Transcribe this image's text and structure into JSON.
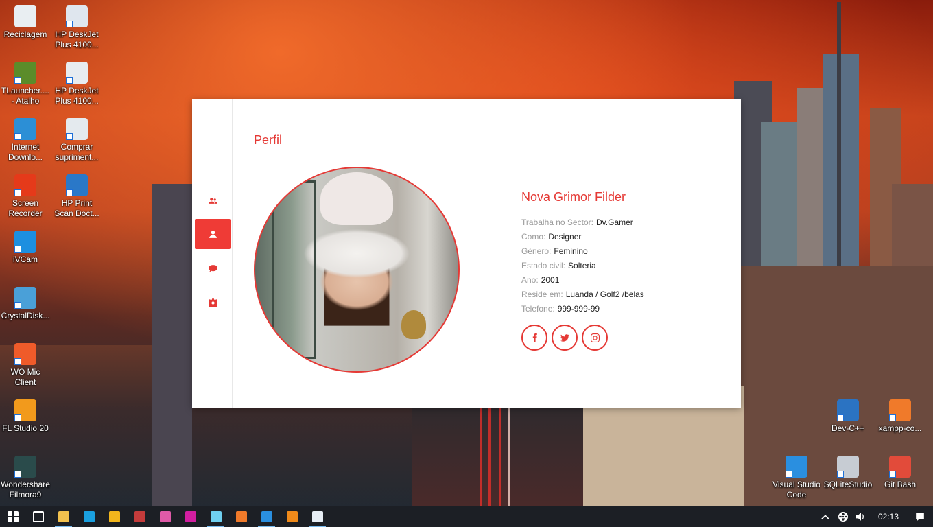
{
  "desktop": {
    "left_icons": [
      {
        "label": "Reciclagem",
        "icon": "recycle-bin-icon",
        "color": "#e9eef2"
      },
      {
        "label": "TLauncher....\n- Atalho",
        "icon": "minecraft-grass-icon",
        "color": "#5b8c2a"
      },
      {
        "label": "Internet\nDownlo...",
        "icon": "internet-download-manager-icon",
        "color": "#2c8fd6"
      },
      {
        "label": "Screen\nRecorder",
        "icon": "screen-recorder-icon",
        "color": "#e53a1a"
      },
      {
        "label": "iVCam",
        "icon": "ivcam-icon",
        "color": "#1d8fe0"
      },
      {
        "label": "CrystalDisk...",
        "icon": "crystaldisk-icon",
        "color": "#4aa0d8"
      },
      {
        "label": "WO Mic\nClient",
        "icon": "microphone-icon",
        "color": "#ef5b2a"
      },
      {
        "label": "FL Studio 20",
        "icon": "fl-studio-icon",
        "color": "#f29a1c"
      },
      {
        "label": "Wondershare\nFilmora9",
        "icon": "filmora-icon",
        "color": "#2a4b4b"
      }
    ],
    "second_col_icons": [
      {
        "label": "HP DeskJet\nPlus 4100...",
        "icon": "printer-scan-icon",
        "color": "#dfe6ee"
      },
      {
        "label": "HP DeskJet\nPlus 4100...",
        "icon": "printer-icon",
        "color": "#e8ecef"
      },
      {
        "label": "Comprar\nsupriment...",
        "icon": "printer-cart-icon",
        "color": "#e4eaee"
      },
      {
        "label": "HP Print\nScan Doct...",
        "icon": "hp-print-scan-doctor-icon",
        "color": "#2a78c8"
      }
    ],
    "right_icons": [
      {
        "label": "Dev-C++",
        "icon": "dev-cpp-icon",
        "color": "#2b73c2"
      },
      {
        "label": "xampp-co...",
        "icon": "xampp-icon",
        "color": "#f07a2a"
      },
      {
        "label": "Visual Studio\nCode",
        "icon": "vscode-icon",
        "color": "#2a8fe0"
      },
      {
        "label": "SQLiteStudio",
        "icon": "sqlite-studio-icon",
        "color": "#c7ccd3"
      },
      {
        "label": "Git Bash",
        "icon": "git-bash-icon",
        "color": "#e24b3a"
      }
    ]
  },
  "profile": {
    "title": "Perfil",
    "name": "Nova Grimor Filder",
    "fields": [
      {
        "label": "Trabalha no Sector:",
        "value": "Dv.Gamer"
      },
      {
        "label": "Como:",
        "value": "Designer"
      },
      {
        "label": "Género:",
        "value": "Feminino"
      },
      {
        "label": "Estado civil:",
        "value": "Solteria"
      },
      {
        "label": "Ano:",
        "value": "2001"
      },
      {
        "label": "Reside em:",
        "value": "Luanda / Golf2 /belas"
      },
      {
        "label": "Telefone:",
        "value": "999-999-99"
      }
    ],
    "nav": [
      {
        "icon": "users-icon",
        "active": false
      },
      {
        "icon": "user-icon",
        "active": true
      },
      {
        "icon": "comment-icon",
        "active": false
      },
      {
        "icon": "gear-icon",
        "active": false
      }
    ],
    "socials": [
      "facebook-icon",
      "twitter-icon",
      "instagram-icon"
    ],
    "accent_color": "#e53935"
  },
  "taskbar": {
    "apps": [
      {
        "icon": "windows-start-icon",
        "color": "#ffffff",
        "open": false
      },
      {
        "icon": "task-view-icon",
        "color": "#ffffff",
        "open": false
      },
      {
        "icon": "file-explorer-icon",
        "color": "#f2c14e",
        "open": true
      },
      {
        "icon": "edge-icon",
        "color": "#1aa0e0",
        "open": false
      },
      {
        "icon": "app-yellow-icon",
        "color": "#f2b61c",
        "open": false
      },
      {
        "icon": "access-icon",
        "color": "#c43b3b",
        "open": false
      },
      {
        "icon": "stack-icon",
        "color": "#e05aa8",
        "open": false
      },
      {
        "icon": "app-magenta-icon",
        "color": "#d21ea0",
        "open": false
      },
      {
        "icon": "notepad-icon",
        "color": "#6fd0f0",
        "open": true
      },
      {
        "icon": "xampp-icon",
        "color": "#f07a2a",
        "open": false
      },
      {
        "icon": "vscode-icon",
        "color": "#2a8fe0",
        "open": true
      },
      {
        "icon": "vlc-icon",
        "color": "#f08a1a",
        "open": false
      },
      {
        "icon": "window-app-icon",
        "color": "#e7eef5",
        "open": true
      }
    ],
    "time": "02:13"
  }
}
